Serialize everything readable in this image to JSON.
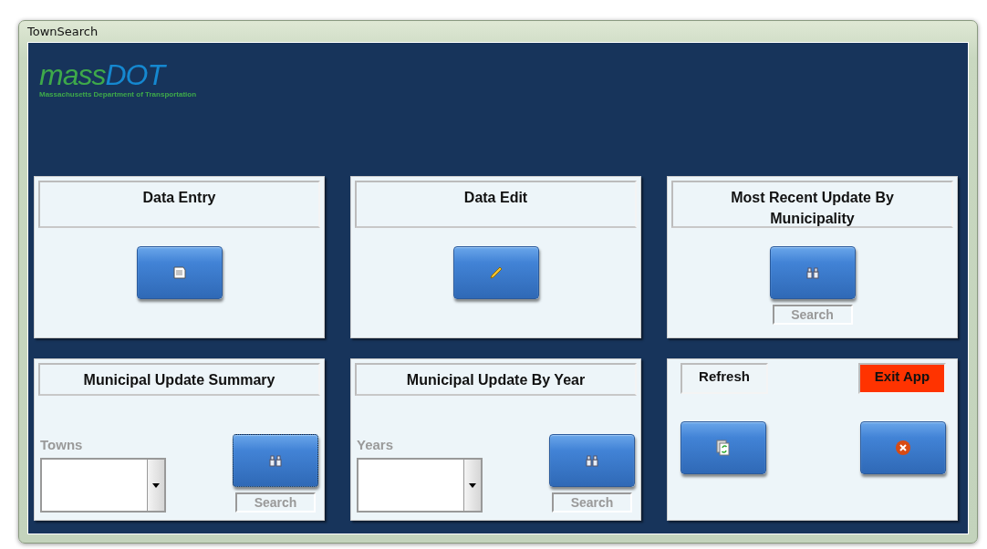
{
  "window": {
    "title": "TownSearch"
  },
  "logo": {
    "brand_left": "mass",
    "brand_right": "DOT",
    "tagline": "Massachusetts Department of Transportation"
  },
  "panels": [
    {
      "kind": "button",
      "title": "Data Entry",
      "focused": false
    },
    {
      "kind": "button",
      "title": "Data Edit",
      "focused": false
    },
    {
      "kind": "search",
      "title": "Most Recent Update By Municipality",
      "focused": false,
      "caption": "Search"
    },
    {
      "kind": "dropdown",
      "title": "Municipal Update Summary",
      "field_label": "Towns",
      "focused": true,
      "caption": "Search"
    },
    {
      "kind": "dropdown",
      "title": "Municipal Update By Year",
      "field_label": "Years",
      "focused": false,
      "caption": "Search"
    },
    {
      "kind": "actions",
      "actions": [
        {
          "label": "Refresh",
          "color": "#eef5f8"
        },
        {
          "label": "Exit App",
          "color": "#ff3300"
        }
      ]
    }
  ]
}
